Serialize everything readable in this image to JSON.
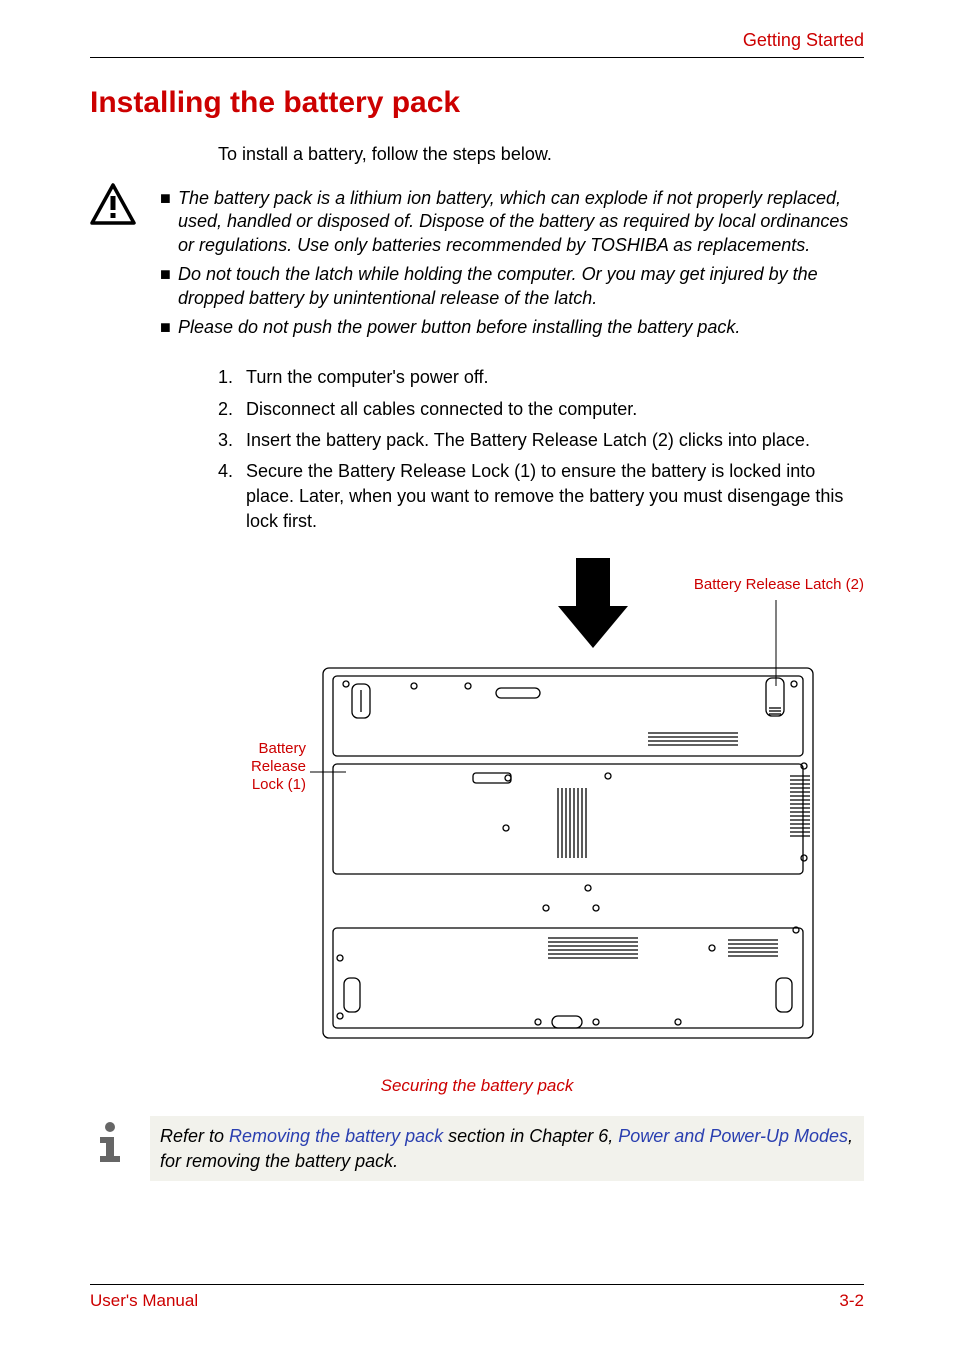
{
  "header": {
    "section": "Getting Started"
  },
  "title": "Installing the battery pack",
  "intro": "To install a battery, follow the steps below.",
  "warning": {
    "bullets": [
      "The battery pack is a lithium ion battery, which can explode if not properly replaced, used, handled or disposed of. Dispose of the battery as required by local ordinances or regulations. Use only batteries recommended by TOSHIBA as replacements.",
      "Do not touch the latch while holding the computer. Or you may get injured by the dropped battery by unintentional release of the latch.",
      "Please do not push the power button before installing the battery pack."
    ]
  },
  "steps": [
    {
      "num": "1.",
      "text": "Turn the computer's power off."
    },
    {
      "num": "2.",
      "text": "Disconnect all cables connected to the computer."
    },
    {
      "num": "3.",
      "text": "Insert the battery pack. The Battery Release Latch (2) clicks into place."
    },
    {
      "num": "4.",
      "text": "Secure the Battery Release Lock (1) to ensure the battery is locked into place. Later, when you want to remove the battery you must disengage this lock first."
    }
  ],
  "figure": {
    "label_latch": "Battery Release Latch (2)",
    "label_lock_l1": "Battery",
    "label_lock_l2": "Release",
    "label_lock_l3": "Lock (1)",
    "caption": "Securing the battery pack"
  },
  "info": {
    "pre": "Refer to ",
    "link1": "Removing the battery pack",
    "mid": " section in Chapter 6, ",
    "link2": "Power and Power-Up Modes",
    "post": ", for removing the battery pack."
  },
  "footer": {
    "left": "User's Manual",
    "right": "3-2"
  }
}
